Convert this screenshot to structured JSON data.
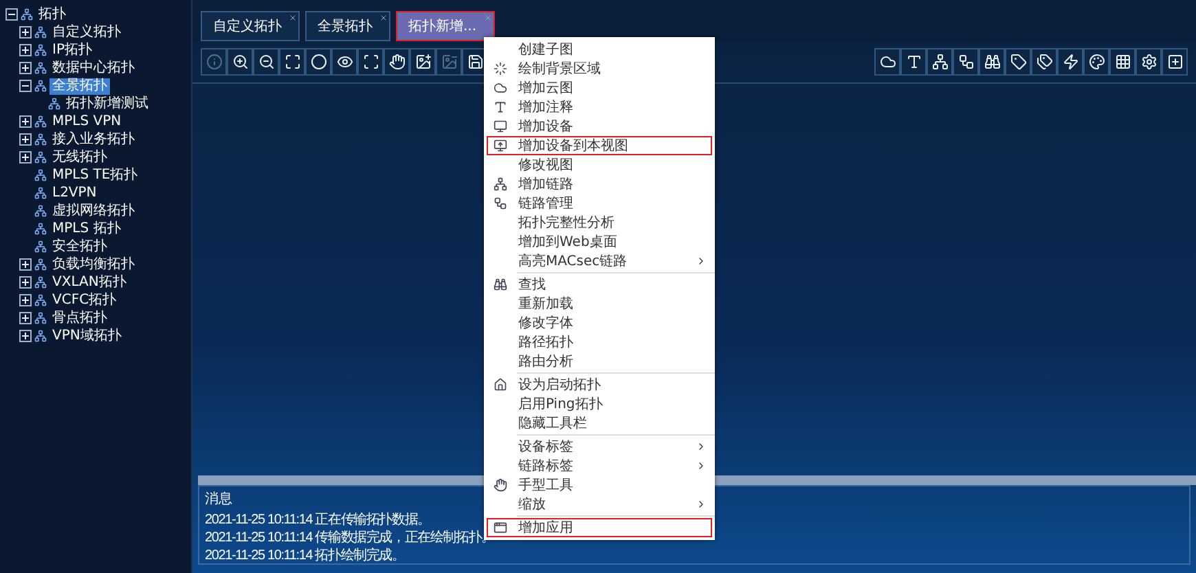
{
  "tree": [
    {
      "label": "拓扑",
      "expanded": true,
      "selected": false,
      "children": [
        {
          "label": "自定义拓扑",
          "expanded": false,
          "selected": false
        },
        {
          "label": "IP拓扑",
          "expanded": false,
          "selected": false
        },
        {
          "label": "数据中心拓扑",
          "expanded": false,
          "selected": false
        },
        {
          "label": "全景拓扑",
          "expanded": true,
          "selected": true,
          "children": [
            {
              "label": "拓扑新增测试",
              "selected": false
            }
          ]
        },
        {
          "label": "MPLS VPN",
          "expanded": false,
          "selected": false
        },
        {
          "label": "接入业务拓扑",
          "expanded": false,
          "selected": false
        },
        {
          "label": "无线拓扑",
          "expanded": false,
          "selected": false
        },
        {
          "label": "MPLS TE拓扑",
          "selected": false
        },
        {
          "label": "L2VPN",
          "selected": false
        },
        {
          "label": "虚拟网络拓扑",
          "selected": false
        },
        {
          "label": "MPLS 拓扑",
          "selected": false
        },
        {
          "label": "安全拓扑",
          "selected": false
        },
        {
          "label": "负载均衡拓扑",
          "expanded": false,
          "selected": false
        },
        {
          "label": "VXLAN拓扑",
          "expanded": false,
          "selected": false
        },
        {
          "label": "VCFC拓扑",
          "expanded": false,
          "selected": false
        },
        {
          "label": "骨点拓扑",
          "expanded": false,
          "selected": false
        },
        {
          "label": "VPN域拓扑",
          "expanded": false,
          "selected": false
        }
      ]
    }
  ],
  "tabs": [
    {
      "label": "自定义拓扑",
      "selected": false,
      "highlighted": false
    },
    {
      "label": "全景拓扑",
      "selected": false,
      "highlighted": false
    },
    {
      "label": "拓扑新增...",
      "selected": true,
      "highlighted": true
    }
  ],
  "toolbar_left": [
    {
      "disabled": true
    },
    {
      "disabled": false
    },
    {
      "disabled": false
    },
    {
      "disabled": false
    },
    {
      "disabled": false
    },
    {
      "disabled": false
    },
    {
      "disabled": false
    },
    {
      "disabled": false
    },
    {
      "disabled": false
    },
    {
      "disabled": true
    },
    {
      "disabled": false
    }
  ],
  "toolbar_right": [
    {
      "disabled": false
    },
    {
      "disabled": false
    },
    {
      "disabled": false
    },
    {
      "disabled": false
    },
    {
      "disabled": false
    },
    {
      "disabled": false
    },
    {
      "disabled": false
    },
    {
      "disabled": false
    },
    {
      "disabled": false
    },
    {
      "disabled": false
    },
    {
      "disabled": false
    },
    {
      "disabled": false
    }
  ],
  "log": {
    "title": "消息",
    "lines": [
      "2021-11-25 10:11:14 正在传输拓扑数据。",
      "2021-11-25 10:11:14 传输数据完成，正在绘制拓扑。",
      "2021-11-25 10:11:14 拓扑绘制完成。"
    ]
  },
  "context_menu": {
    "groups": [
      [
        {
          "label": "创建子图",
          "highlighted": false
        },
        {
          "label": "绘制背景区域",
          "highlighted": false
        },
        {
          "label": "增加云图",
          "highlighted": false
        },
        {
          "label": "增加注释",
          "highlighted": false
        },
        {
          "label": "增加设备",
          "highlighted": false
        },
        {
          "label": "增加设备到本视图",
          "highlighted": true
        },
        {
          "label": "修改视图",
          "highlighted": false
        },
        {
          "label": "增加链路",
          "highlighted": false
        },
        {
          "label": "链路管理",
          "highlighted": false
        },
        {
          "label": "拓扑完整性分析",
          "highlighted": false
        },
        {
          "label": "增加到Web桌面",
          "highlighted": false
        },
        {
          "label": "高亮MACsec链路",
          "submenu": true,
          "highlighted": false
        }
      ],
      [
        {
          "label": "查找",
          "highlighted": false
        },
        {
          "label": "重新加载",
          "highlighted": false
        },
        {
          "label": "修改字体",
          "highlighted": false
        },
        {
          "label": "路径拓扑",
          "highlighted": false
        },
        {
          "label": "路由分析",
          "highlighted": false
        }
      ],
      [
        {
          "label": "设为启动拓扑",
          "highlighted": false
        },
        {
          "label": "启用Ping拓扑",
          "highlighted": false
        },
        {
          "label": "隐藏工具栏",
          "highlighted": false
        }
      ],
      [
        {
          "label": "设备标签",
          "submenu": true,
          "highlighted": false
        },
        {
          "label": "链路标签",
          "submenu": true,
          "highlighted": false
        },
        {
          "label": "手型工具",
          "highlighted": false
        },
        {
          "label": "缩放",
          "submenu": true,
          "highlighted": false
        }
      ],
      [
        {
          "label": "增加应用",
          "highlighted": true
        }
      ]
    ]
  }
}
